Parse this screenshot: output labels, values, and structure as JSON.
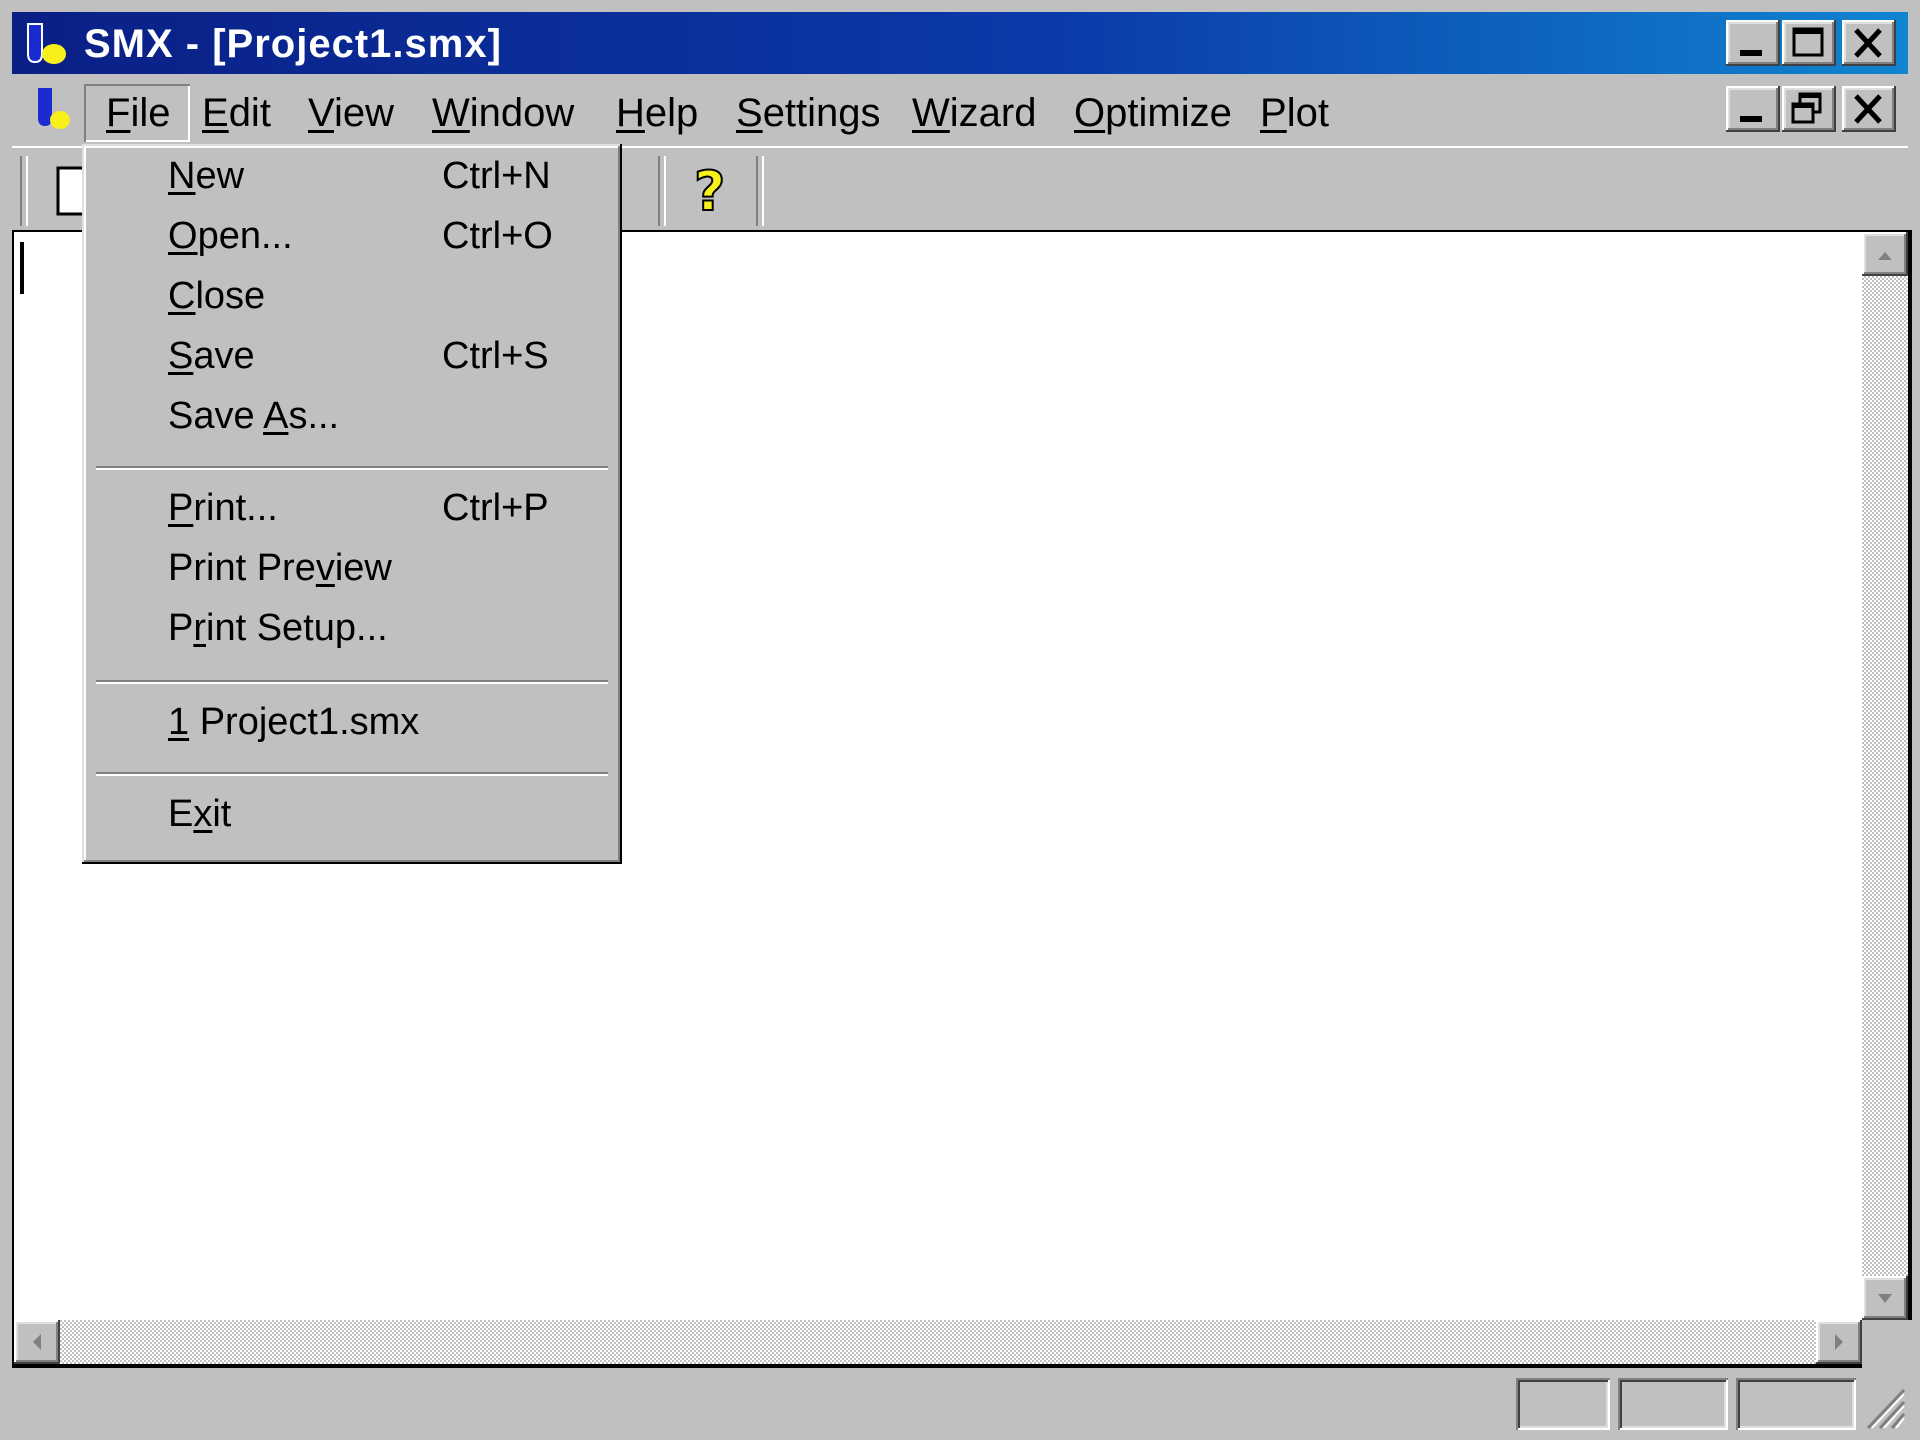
{
  "window": {
    "title": "SMX - [Project1.smx]",
    "colors": {
      "titlebar_start": "#0a1f86",
      "titlebar_end": "#1084d0",
      "face": "#c0c0c0"
    },
    "caption_buttons": [
      "minimize",
      "maximize",
      "close"
    ],
    "document_buttons": [
      "minimize",
      "restore",
      "close"
    ]
  },
  "menubar": {
    "items": [
      {
        "pre": "",
        "key": "F",
        "post": "ile"
      },
      {
        "pre": "",
        "key": "E",
        "post": "dit"
      },
      {
        "pre": "",
        "key": "V",
        "post": "iew"
      },
      {
        "pre": "",
        "key": "W",
        "post": "indow"
      },
      {
        "pre": "",
        "key": "H",
        "post": "elp"
      },
      {
        "pre": "",
        "key": "S",
        "post": "ettings"
      },
      {
        "pre": "",
        "key": "W",
        "post": "izard"
      },
      {
        "pre": "",
        "key": "O",
        "post": "ptimize"
      },
      {
        "pre": "",
        "key": "P",
        "post": "lot"
      }
    ]
  },
  "toolbar": {
    "icons": [
      "new-document-icon",
      "settings-gear-icon",
      "help-question-icon"
    ]
  },
  "filemenu": {
    "items": [
      {
        "pre": "",
        "key": "N",
        "post": "ew",
        "shortcut": "Ctrl+N"
      },
      {
        "pre": "",
        "key": "O",
        "post": "pen...",
        "shortcut": "Ctrl+O"
      },
      {
        "pre": "",
        "key": "C",
        "post": "lose",
        "shortcut": ""
      },
      {
        "pre": "",
        "key": "S",
        "post": "ave",
        "shortcut": "Ctrl+S"
      },
      {
        "pre": "Save ",
        "key": "A",
        "post": "s...",
        "shortcut": ""
      },
      {
        "pre": "",
        "key": "P",
        "post": "rint...",
        "shortcut": "Ctrl+P"
      },
      {
        "pre": "Print Pre",
        "key": "v",
        "post": "iew",
        "shortcut": ""
      },
      {
        "pre": "P",
        "key": "r",
        "post": "int Setup...",
        "shortcut": ""
      },
      {
        "pre": "",
        "key": "1",
        "post": " Project1.smx",
        "shortcut": ""
      },
      {
        "pre": "E",
        "key": "x",
        "post": "it",
        "shortcut": ""
      }
    ]
  }
}
